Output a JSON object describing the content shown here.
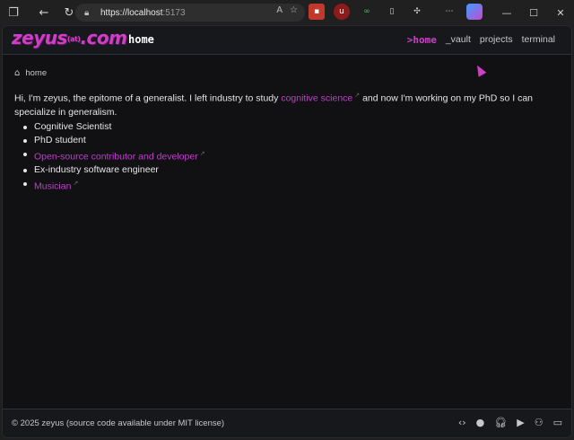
{
  "browser": {
    "url_host": "https://localhost",
    "url_port": ":5173",
    "reader_icon": "A",
    "star_icon": "☆"
  },
  "site": {
    "logo": "zeyus",
    "logo_at": "(at)",
    "logo_tld": ".com",
    "page_name": "home",
    "nav": [
      {
        "label": ">home"
      },
      {
        "label": "_vault"
      },
      {
        "label": "projects"
      },
      {
        "label": "terminal"
      }
    ]
  },
  "breadcrumb": {
    "label": "home"
  },
  "intro": {
    "before_link": "Hi, I'm zeyus, the epitome of a generalist. I left industry to study ",
    "link": "cognitive science",
    "after_link": " and now I'm working on my PhD so I can specialize in generalism."
  },
  "facts": [
    {
      "text": "Cognitive Scientist",
      "link": false
    },
    {
      "text": "PhD student",
      "link": false
    },
    {
      "text": "Open-source contributor and developer",
      "link": true
    },
    {
      "text": "Ex-industry software engineer",
      "link": false
    },
    {
      "text": "Musician",
      "link": true
    }
  ],
  "footer": {
    "copyright": "© 2025 zeyus (source code available under MIT license)"
  },
  "colors": {
    "accent": "#c23ccf",
    "background": "#111113"
  }
}
